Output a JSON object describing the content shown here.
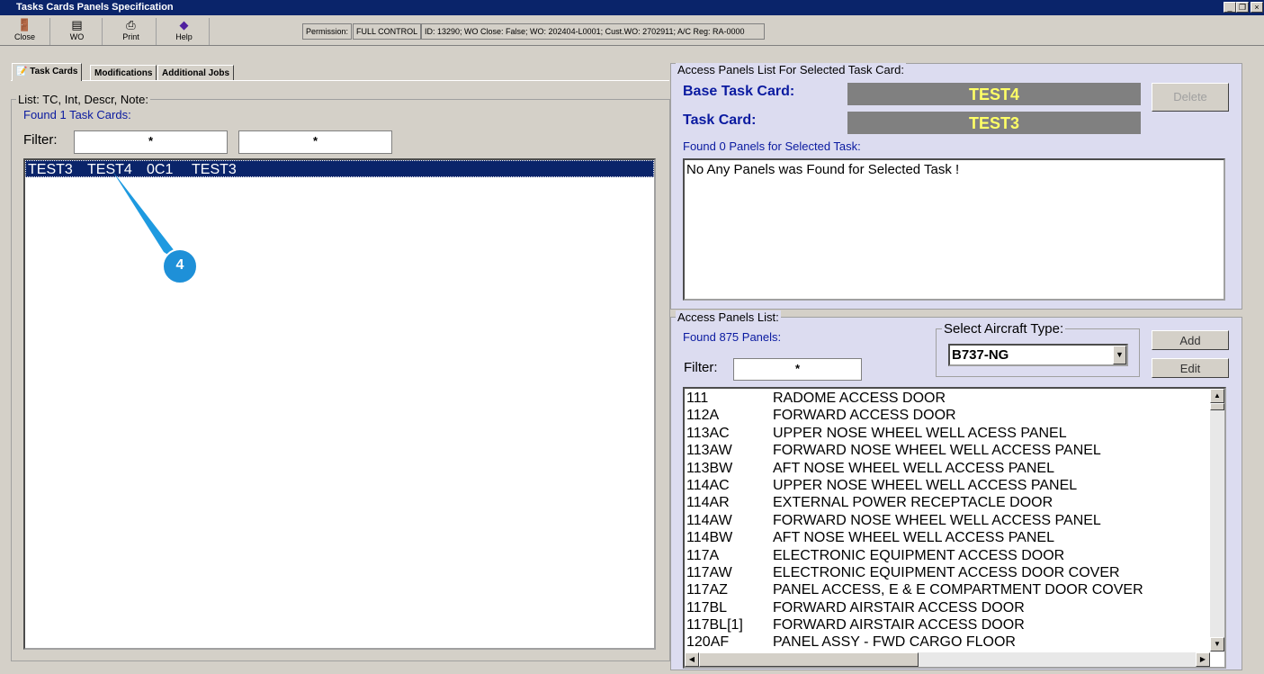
{
  "window": {
    "title": "Tasks Cards Panels Specification"
  },
  "toolbar": {
    "close": "Close",
    "wo": "WO",
    "print": "Print",
    "help": "Help"
  },
  "status": {
    "permission_label": "Permission:",
    "permission_value": "FULL CONTROL",
    "info": "ID: 13290; WO Close: False; WO: 202404-L0001; Cust.WO: 2702911; A/C Reg: RA-0000"
  },
  "tabs": [
    "Task Cards",
    "Modifications",
    "Additional Jobs"
  ],
  "left": {
    "group_title": "List: TC, Int, Descr, Note:",
    "found": "Found 1 Task Cards:",
    "filter_label": "Filter:",
    "filter1": "*",
    "filter2": "*",
    "rows": [
      {
        "c1": "TEST3",
        "c2": "TEST4",
        "c3": "0C1",
        "c4": "TEST3"
      }
    ]
  },
  "callout": {
    "number": "4"
  },
  "right_top": {
    "group_title": "Access Panels List For Selected Task Card:",
    "base_label": "Base Task Card:",
    "base_value": "TEST4",
    "tc_label": "Task Card:",
    "tc_value": "TEST3",
    "delete": "Delete",
    "found": "Found 0 Panels for Selected Task:",
    "message": "No Any Panels was Found for Selected Task !"
  },
  "right_bottom": {
    "group_title": "Access Panels List:",
    "found": "Found 875 Panels:",
    "aircraft_label": "Select Aircraft Type:",
    "aircraft_value": "B737-NG",
    "add": "Add",
    "edit": "Edit",
    "filter_label": "Filter:",
    "filter": "*",
    "panels": [
      [
        "111",
        "RADOME ACCESS DOOR"
      ],
      [
        "112A",
        "FORWARD ACCESS DOOR"
      ],
      [
        "113AC",
        "UPPER NOSE WHEEL WELL ACESS PANEL"
      ],
      [
        "113AW",
        "FORWARD NOSE WHEEL WELL ACCESS PANEL"
      ],
      [
        "113BW",
        "AFT NOSE WHEEL WELL ACCESS PANEL"
      ],
      [
        "114AC",
        "UPPER NOSE WHEEL WELL ACCESS PANEL"
      ],
      [
        "114AR",
        "EXTERNAL POWER RECEPTACLE DOOR"
      ],
      [
        "114AW",
        "FORWARD NOSE WHEEL WELL ACCESS PANEL"
      ],
      [
        "114BW",
        "AFT NOSE WHEEL WELL ACCESS PANEL"
      ],
      [
        "117A",
        "ELECTRONIC EQUIPMENT ACCESS DOOR"
      ],
      [
        "117AW",
        "ELECTRONIC EQUIPMENT ACCESS DOOR COVER"
      ],
      [
        "117AZ",
        "PANEL ACCESS, E & E COMPARTMENT DOOR COVER"
      ],
      [
        "117BL",
        "FORWARD AIRSTAIR ACCESS DOOR"
      ],
      [
        "117BL[1]",
        "FORWARD AIRSTAIR ACCESS DOOR"
      ],
      [
        "120AF",
        "PANEL ASSY - FWD CARGO FLOOR"
      ]
    ]
  }
}
